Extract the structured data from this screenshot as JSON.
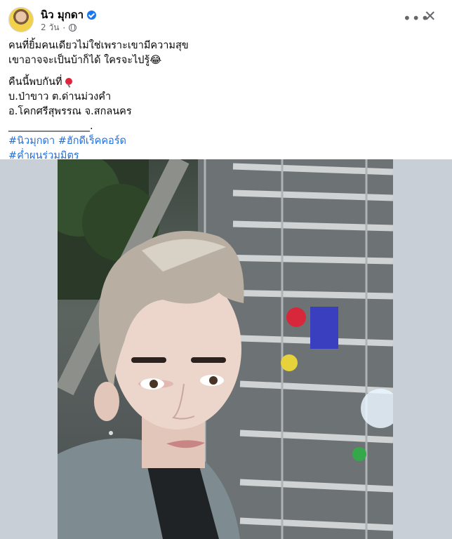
{
  "post": {
    "author": "นิว มุกดา",
    "time": "2 วัน",
    "lines": [
      "คนที่ยิ้มคนเดียวไม่ใช่เพราะเขามีความสุข",
      "เขาอาจจะเป็นบ้าก็ได้ ใครจะไปรู้😂",
      "คืนนี้พบกันที่",
      "บ.ป่าขาว ต.ด่านม่วงคำ",
      "อ.โคกศรีสุพรรณ จ.สกลนคร",
      "________________."
    ],
    "hashtags": [
      "#นิวมุกดา #ฮักดีเร็คคอร์ด",
      "#ค่ำผุนร่วมมิตร"
    ]
  },
  "icons": {
    "verified": "verified-badge-icon",
    "globe": "public-globe-icon",
    "more": "more-options-icon",
    "close": "close-icon",
    "pin": "pushpin-icon"
  },
  "colors": {
    "verified": "#1877f2",
    "hashtag": "#216fdb",
    "meta": "#65676b",
    "photo_backdrop": "#c9cfd6"
  }
}
